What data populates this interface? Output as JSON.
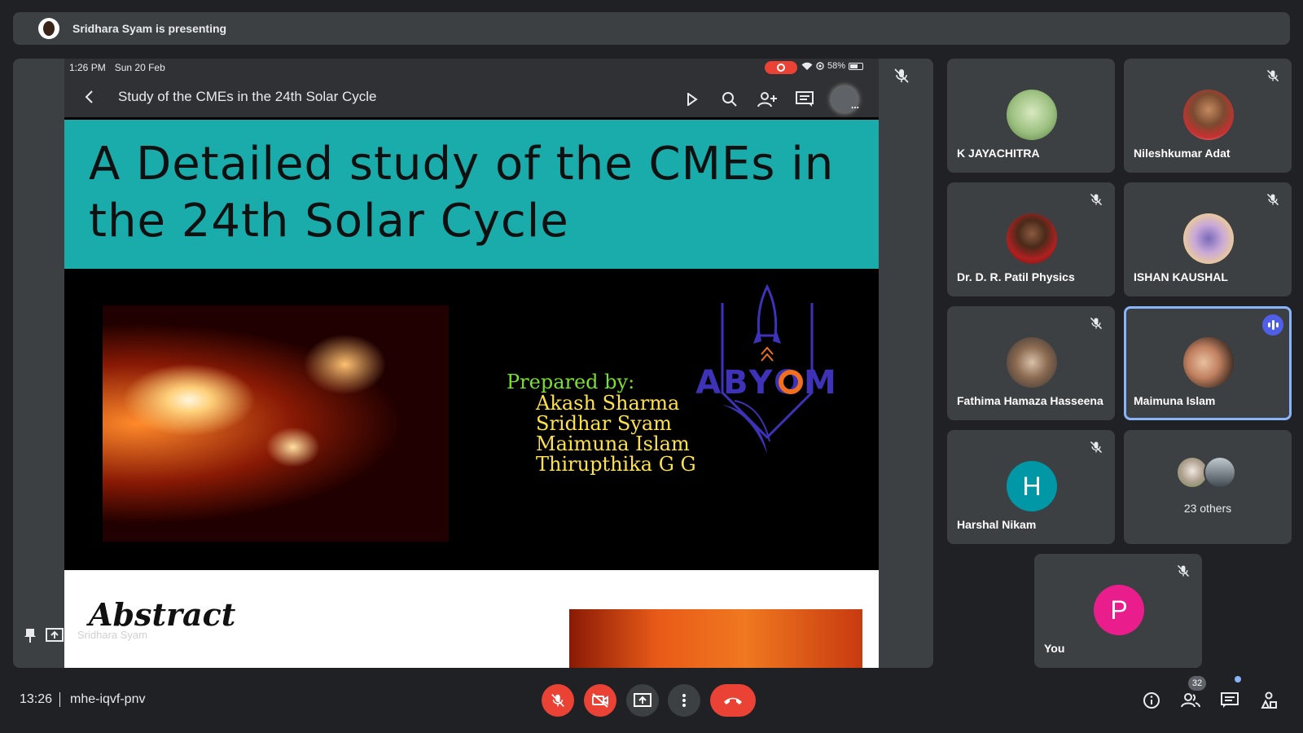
{
  "banner": {
    "text": "Sridhara Syam is presenting"
  },
  "tablet": {
    "time": "1:26 PM",
    "date": "Sun 20 Feb",
    "battery": "58%",
    "doc_title": "Study of the CMEs in the 24th Solar Cycle"
  },
  "slide": {
    "title": "A Detailed study of the CMEs in the 24th Solar Cycle",
    "prepared_by": "Prepared by:",
    "authors": [
      "Akash Sharma",
      "Sridhar Syam",
      "Maimuna Islam",
      "Thirupthika G G"
    ],
    "logo_text": "ABYOM",
    "abstract_heading": "Abstract"
  },
  "presenter_name": "Sridhara Syam",
  "participants": [
    {
      "name": "K JAYACHITRA",
      "muted": false
    },
    {
      "name": "Nileshkumar Adat",
      "muted": true
    },
    {
      "name": "Dr. D. R. Patil Physics",
      "muted": true
    },
    {
      "name": "ISHAN KAUSHAL",
      "muted": true
    },
    {
      "name": "Fathima Hamaza Hasseena",
      "muted": true
    },
    {
      "name": "Maimuna Islam",
      "muted": false,
      "speaking": true
    },
    {
      "name": "Harshal Nikam",
      "muted": true,
      "initial": "H",
      "color": "#0097a7"
    },
    {
      "name": "You",
      "muted": true,
      "initial": "P",
      "color": "#e91e8c"
    }
  ],
  "others": {
    "label": "23 others"
  },
  "bottom": {
    "clock": "13:26",
    "meeting_code": "mhe-iqvf-pnv",
    "participant_count": "32"
  },
  "colors": {
    "accent_red": "#ea4335",
    "active_border": "#8ab4f8",
    "slide_header": "#1aabab"
  }
}
